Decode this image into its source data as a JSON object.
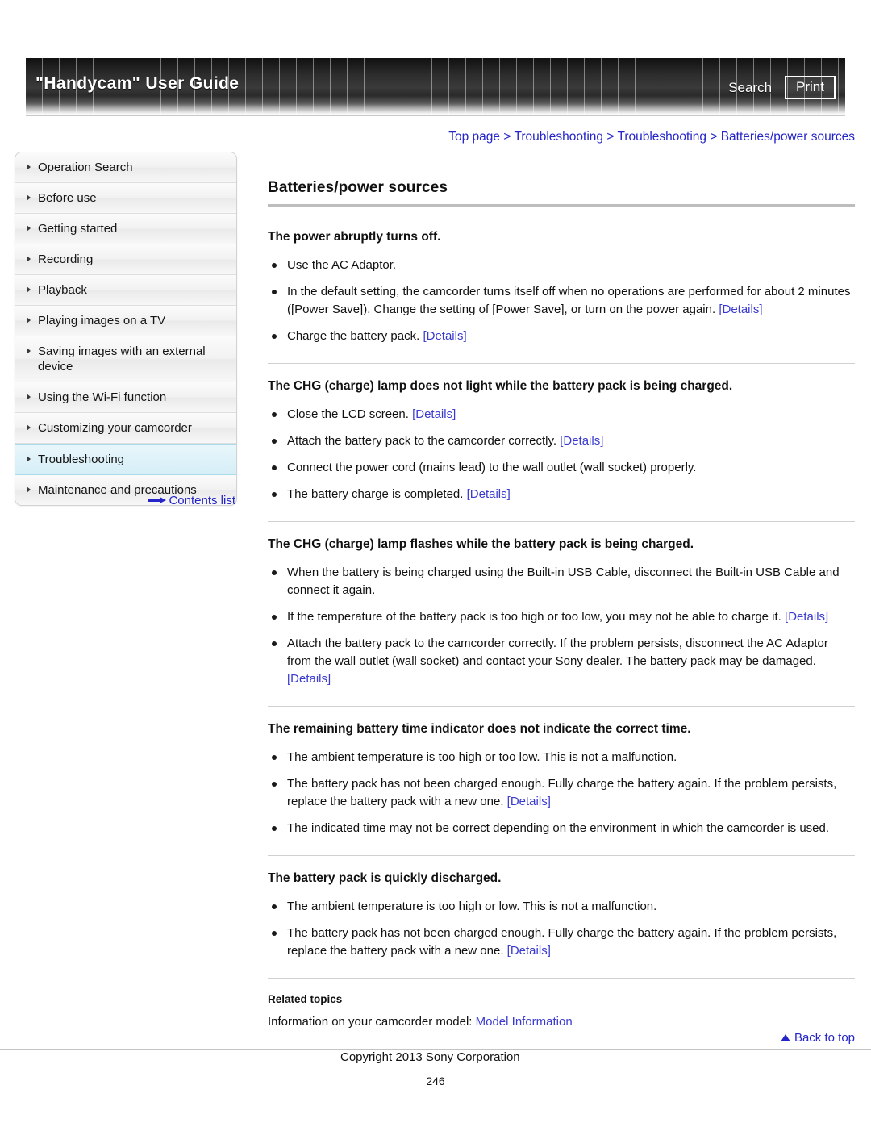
{
  "header": {
    "title": "\"Handycam\" User Guide",
    "search_label": "Search",
    "print_label": "Print"
  },
  "breadcrumb": {
    "items": [
      "Top page",
      "Troubleshooting",
      "Troubleshooting",
      "Batteries/power sources"
    ],
    "separator": ">",
    "full_text": "Top page > Troubleshooting > Troubleshooting > Batteries/power sources"
  },
  "sidebar": {
    "items": [
      {
        "label": "Operation Search",
        "active": false
      },
      {
        "label": "Before use",
        "active": false
      },
      {
        "label": "Getting started",
        "active": false
      },
      {
        "label": "Recording",
        "active": false
      },
      {
        "label": "Playback",
        "active": false
      },
      {
        "label": "Playing images on a TV",
        "active": false
      },
      {
        "label": "Saving images with an external device",
        "active": false
      },
      {
        "label": "Using the Wi-Fi function",
        "active": false
      },
      {
        "label": "Customizing your camcorder",
        "active": false
      },
      {
        "label": "Troubleshooting",
        "active": true
      },
      {
        "label": "Maintenance and precautions",
        "active": false
      }
    ],
    "contents_list_label": "Contents list"
  },
  "main": {
    "page_title": "Batteries/power sources",
    "sections": [
      {
        "heading": "The power abruptly turns off.",
        "bullets": [
          "Use the AC Adaptor.",
          "In the default setting, the camcorder turns itself off when no operations are performed for about 2 minutes ([Power Save]). Change the setting of [Power Save], or turn on the power again. [Details]",
          "Charge the battery pack. [Details]"
        ]
      },
      {
        "heading": "The CHG (charge) lamp does not light while the battery pack is being charged.",
        "bullets": [
          "Close the LCD screen. [Details]",
          "Attach the battery pack to the camcorder correctly. [Details]",
          "Connect the power cord (mains lead) to the wall outlet (wall socket) properly.",
          "The battery charge is completed. [Details]"
        ]
      },
      {
        "heading": "The CHG (charge) lamp flashes while the battery pack is being charged.",
        "bullets": [
          "When the battery is being charged using the Built-in USB Cable, disconnect the Built-in USB Cable and connect it again.",
          "If the temperature of the battery pack is too high or too low, you may not be able to charge it. [Details]",
          "Attach the battery pack to the camcorder correctly. If the problem persists, disconnect the AC Adaptor from the wall outlet (wall socket) and contact your Sony dealer. The battery pack may be damaged. [Details]"
        ]
      },
      {
        "heading": "The remaining battery time indicator does not indicate the correct time.",
        "bullets": [
          "The ambient temperature is too high or too low. This is not a malfunction.",
          "The battery pack has not been charged enough. Fully charge the battery again. If the problem persists, replace the battery pack with a new one. [Details]",
          "The indicated time may not be correct depending on the environment in which the camcorder is used."
        ]
      },
      {
        "heading": "The battery pack is quickly discharged.",
        "bullets": [
          "The ambient temperature is too high or low. This is not a malfunction.",
          "The battery pack has not been charged enough. Fully charge the battery again. If the problem persists, replace the battery pack with a new one. [Details]"
        ]
      }
    ],
    "related": {
      "title": "Related topics",
      "prefix": "Information on your camcorder model: ",
      "link_label": "Model Information"
    }
  },
  "footer": {
    "back_to_top_label": "Back to top",
    "copyright": "Copyright 2013 Sony Corporation",
    "page_number": "246"
  },
  "colors": {
    "link": "#3a3ad0",
    "breadcrumb": "#2424c8",
    "active_nav_bg": "#dff2f9",
    "active_nav_border": "#a8dce8",
    "header_dark": "#2b2b2b"
  }
}
